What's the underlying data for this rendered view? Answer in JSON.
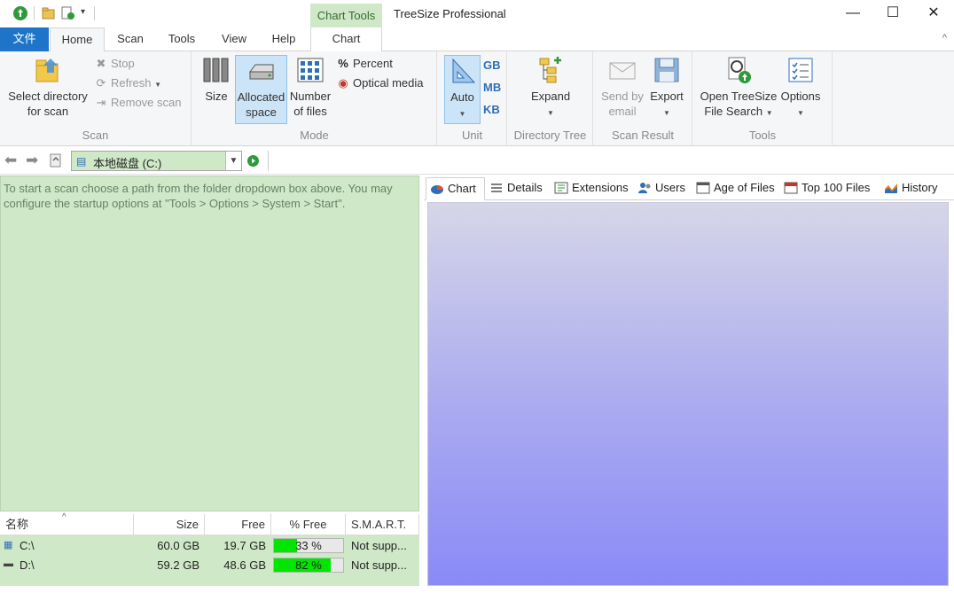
{
  "titlebar": {
    "app_title": "TreeSize Professional",
    "context_tab": "Chart Tools",
    "minimize": "—",
    "maximize": "☐",
    "close": "✕"
  },
  "tabs": {
    "file": "文件",
    "home": "Home",
    "scan": "Scan",
    "tools": "Tools",
    "view": "View",
    "help": "Help",
    "chart": "Chart",
    "collapse": "^"
  },
  "ribbon": {
    "scan_group": {
      "label": "Scan",
      "select_directory": "Select directory",
      "for_scan": "for scan",
      "stop": "Stop",
      "refresh": "Refresh",
      "remove_scan": "Remove scan"
    },
    "mode_group": {
      "label": "Mode",
      "size": "Size",
      "allocated_line1": "Allocated",
      "allocated_line2": "space",
      "number_line1": "Number",
      "number_line2": "of files",
      "percent": "Percent",
      "optical_media": "Optical media"
    },
    "unit_group": {
      "label": "Unit",
      "auto": "Auto",
      "gb": "GB",
      "mb": "MB",
      "kb": "KB"
    },
    "tree_group": {
      "label": "Directory Tree",
      "expand": "Expand"
    },
    "result_group": {
      "label": "Scan Result",
      "send_line1": "Send by",
      "send_line2": "email",
      "export": "Export"
    },
    "tools_group": {
      "label": "Tools",
      "open_line1": "Open TreeSize",
      "open_line2": "File Search",
      "options": "Options"
    }
  },
  "pathbar": {
    "path_value": "本地磁盘 (C:)"
  },
  "left_panel": {
    "message": "To start a scan choose a path from the folder dropdown box above. You may configure the startup options at \"Tools > Options > System > Start\"."
  },
  "drive_table": {
    "headers": {
      "name": "名称",
      "size": "Size",
      "free": "Free",
      "pct_free": "% Free",
      "smart": "S.M.A.R.T."
    },
    "rows": [
      {
        "name": "C:\\",
        "size": "60.0 GB",
        "free": "19.7 GB",
        "pct_free": "33 %",
        "pct_value": 33,
        "smart": "Not supp..."
      },
      {
        "name": "D:\\",
        "size": "59.2 GB",
        "free": "48.6 GB",
        "pct_free": "82 %",
        "pct_value": 82,
        "smart": "Not supp..."
      }
    ]
  },
  "chart_tabs": {
    "chart": "Chart",
    "details": "Details",
    "extensions": "Extensions",
    "users": "Users",
    "age_of_files": "Age of Files",
    "top100": "Top 100 Files",
    "history": "History"
  },
  "colors": {
    "accent_green": "#cfe8c7",
    "file_tab_blue": "#1e74c8",
    "progress_green": "#00e600"
  }
}
